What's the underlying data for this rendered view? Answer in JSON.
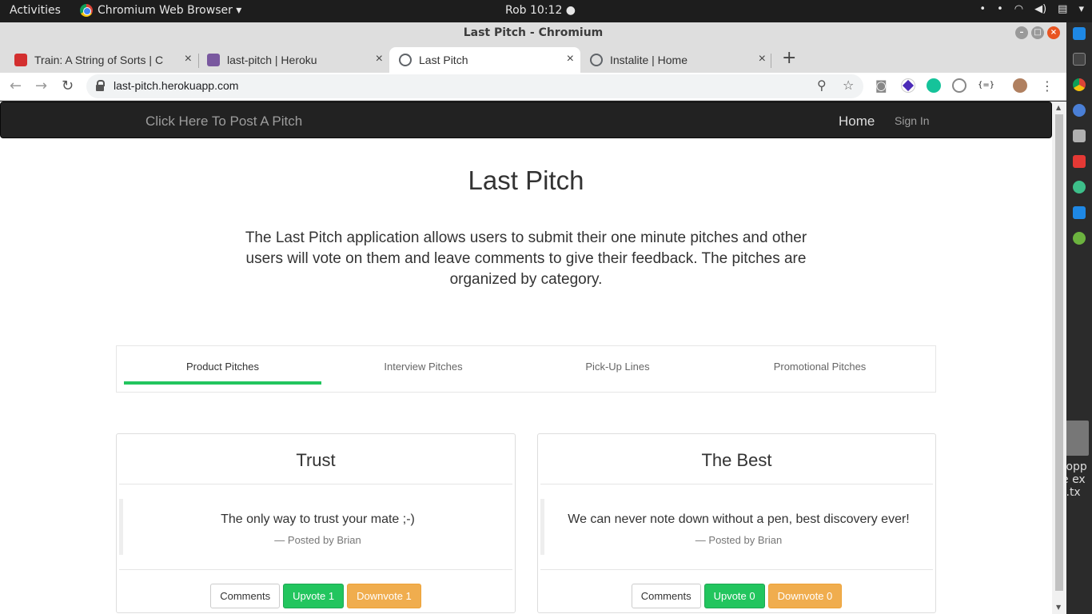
{
  "os": {
    "activities": "Activities",
    "app_menu": "Chromium Web Browser ▾",
    "clock": "Rob 10:12 ●"
  },
  "window": {
    "title": "Last Pitch - Chromium"
  },
  "tabs": [
    {
      "label": "Train: A String of Sorts | C",
      "color": "#d32f2f"
    },
    {
      "label": "last-pitch | Heroku",
      "color": "#79589f"
    },
    {
      "label": "Last Pitch",
      "color": "#5f6368"
    },
    {
      "label": "Instalite | Home",
      "color": "#5f6368"
    }
  ],
  "address_bar": {
    "url": "last-pitch.herokuapp.com"
  },
  "site": {
    "brand": "Click Here To Post A Pitch",
    "nav_home": "Home",
    "nav_signin": "Sign In",
    "title": "Last Pitch",
    "description": "The Last Pitch application allows users to submit their one minute pitches and other users will vote on them and leave comments to give their feedback. The pitches are organized by category.",
    "categories": [
      "Product Pitches",
      "Interview Pitches",
      "Pick-Up Lines",
      "Promotional Pitches"
    ],
    "active_category": "Product Pitches",
    "accent_color": "#22c55e"
  },
  "pitches": [
    {
      "title": "Trust",
      "text": "The only way to trust your mate ;-)",
      "author": "—  Posted by Brian",
      "comments": "Comments",
      "upvote": "Upvote 1",
      "downvote": "Downvote 1"
    },
    {
      "title": "The Best",
      "text": "We can never note down without a pen, best discovery ever!",
      "author": "—  Posted by Brian",
      "comments": "Comments",
      "upvote": "Upvote 0",
      "downvote": "Downvote 0"
    }
  ],
  "desktop": {
    "file_label": "roppe ext.tx"
  }
}
